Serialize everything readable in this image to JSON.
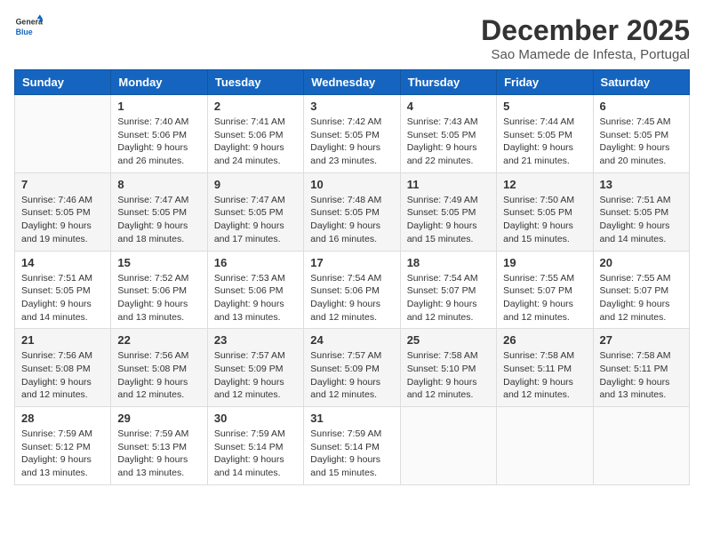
{
  "header": {
    "logo_general": "General",
    "logo_blue": "Blue",
    "month_title": "December 2025",
    "subtitle": "Sao Mamede de Infesta, Portugal"
  },
  "weekdays": [
    "Sunday",
    "Monday",
    "Tuesday",
    "Wednesday",
    "Thursday",
    "Friday",
    "Saturday"
  ],
  "weeks": [
    [
      {
        "day": "",
        "info": ""
      },
      {
        "day": "1",
        "info": "Sunrise: 7:40 AM\nSunset: 5:06 PM\nDaylight: 9 hours\nand 26 minutes."
      },
      {
        "day": "2",
        "info": "Sunrise: 7:41 AM\nSunset: 5:06 PM\nDaylight: 9 hours\nand 24 minutes."
      },
      {
        "day": "3",
        "info": "Sunrise: 7:42 AM\nSunset: 5:05 PM\nDaylight: 9 hours\nand 23 minutes."
      },
      {
        "day": "4",
        "info": "Sunrise: 7:43 AM\nSunset: 5:05 PM\nDaylight: 9 hours\nand 22 minutes."
      },
      {
        "day": "5",
        "info": "Sunrise: 7:44 AM\nSunset: 5:05 PM\nDaylight: 9 hours\nand 21 minutes."
      },
      {
        "day": "6",
        "info": "Sunrise: 7:45 AM\nSunset: 5:05 PM\nDaylight: 9 hours\nand 20 minutes."
      }
    ],
    [
      {
        "day": "7",
        "info": "Sunrise: 7:46 AM\nSunset: 5:05 PM\nDaylight: 9 hours\nand 19 minutes."
      },
      {
        "day": "8",
        "info": "Sunrise: 7:47 AM\nSunset: 5:05 PM\nDaylight: 9 hours\nand 18 minutes."
      },
      {
        "day": "9",
        "info": "Sunrise: 7:47 AM\nSunset: 5:05 PM\nDaylight: 9 hours\nand 17 minutes."
      },
      {
        "day": "10",
        "info": "Sunrise: 7:48 AM\nSunset: 5:05 PM\nDaylight: 9 hours\nand 16 minutes."
      },
      {
        "day": "11",
        "info": "Sunrise: 7:49 AM\nSunset: 5:05 PM\nDaylight: 9 hours\nand 15 minutes."
      },
      {
        "day": "12",
        "info": "Sunrise: 7:50 AM\nSunset: 5:05 PM\nDaylight: 9 hours\nand 15 minutes."
      },
      {
        "day": "13",
        "info": "Sunrise: 7:51 AM\nSunset: 5:05 PM\nDaylight: 9 hours\nand 14 minutes."
      }
    ],
    [
      {
        "day": "14",
        "info": "Sunrise: 7:51 AM\nSunset: 5:05 PM\nDaylight: 9 hours\nand 14 minutes."
      },
      {
        "day": "15",
        "info": "Sunrise: 7:52 AM\nSunset: 5:06 PM\nDaylight: 9 hours\nand 13 minutes."
      },
      {
        "day": "16",
        "info": "Sunrise: 7:53 AM\nSunset: 5:06 PM\nDaylight: 9 hours\nand 13 minutes."
      },
      {
        "day": "17",
        "info": "Sunrise: 7:54 AM\nSunset: 5:06 PM\nDaylight: 9 hours\nand 12 minutes."
      },
      {
        "day": "18",
        "info": "Sunrise: 7:54 AM\nSunset: 5:07 PM\nDaylight: 9 hours\nand 12 minutes."
      },
      {
        "day": "19",
        "info": "Sunrise: 7:55 AM\nSunset: 5:07 PM\nDaylight: 9 hours\nand 12 minutes."
      },
      {
        "day": "20",
        "info": "Sunrise: 7:55 AM\nSunset: 5:07 PM\nDaylight: 9 hours\nand 12 minutes."
      }
    ],
    [
      {
        "day": "21",
        "info": "Sunrise: 7:56 AM\nSunset: 5:08 PM\nDaylight: 9 hours\nand 12 minutes."
      },
      {
        "day": "22",
        "info": "Sunrise: 7:56 AM\nSunset: 5:08 PM\nDaylight: 9 hours\nand 12 minutes."
      },
      {
        "day": "23",
        "info": "Sunrise: 7:57 AM\nSunset: 5:09 PM\nDaylight: 9 hours\nand 12 minutes."
      },
      {
        "day": "24",
        "info": "Sunrise: 7:57 AM\nSunset: 5:09 PM\nDaylight: 9 hours\nand 12 minutes."
      },
      {
        "day": "25",
        "info": "Sunrise: 7:58 AM\nSunset: 5:10 PM\nDaylight: 9 hours\nand 12 minutes."
      },
      {
        "day": "26",
        "info": "Sunrise: 7:58 AM\nSunset: 5:11 PM\nDaylight: 9 hours\nand 12 minutes."
      },
      {
        "day": "27",
        "info": "Sunrise: 7:58 AM\nSunset: 5:11 PM\nDaylight: 9 hours\nand 13 minutes."
      }
    ],
    [
      {
        "day": "28",
        "info": "Sunrise: 7:59 AM\nSunset: 5:12 PM\nDaylight: 9 hours\nand 13 minutes."
      },
      {
        "day": "29",
        "info": "Sunrise: 7:59 AM\nSunset: 5:13 PM\nDaylight: 9 hours\nand 13 minutes."
      },
      {
        "day": "30",
        "info": "Sunrise: 7:59 AM\nSunset: 5:14 PM\nDaylight: 9 hours\nand 14 minutes."
      },
      {
        "day": "31",
        "info": "Sunrise: 7:59 AM\nSunset: 5:14 PM\nDaylight: 9 hours\nand 15 minutes."
      },
      {
        "day": "",
        "info": ""
      },
      {
        "day": "",
        "info": ""
      },
      {
        "day": "",
        "info": ""
      }
    ]
  ]
}
